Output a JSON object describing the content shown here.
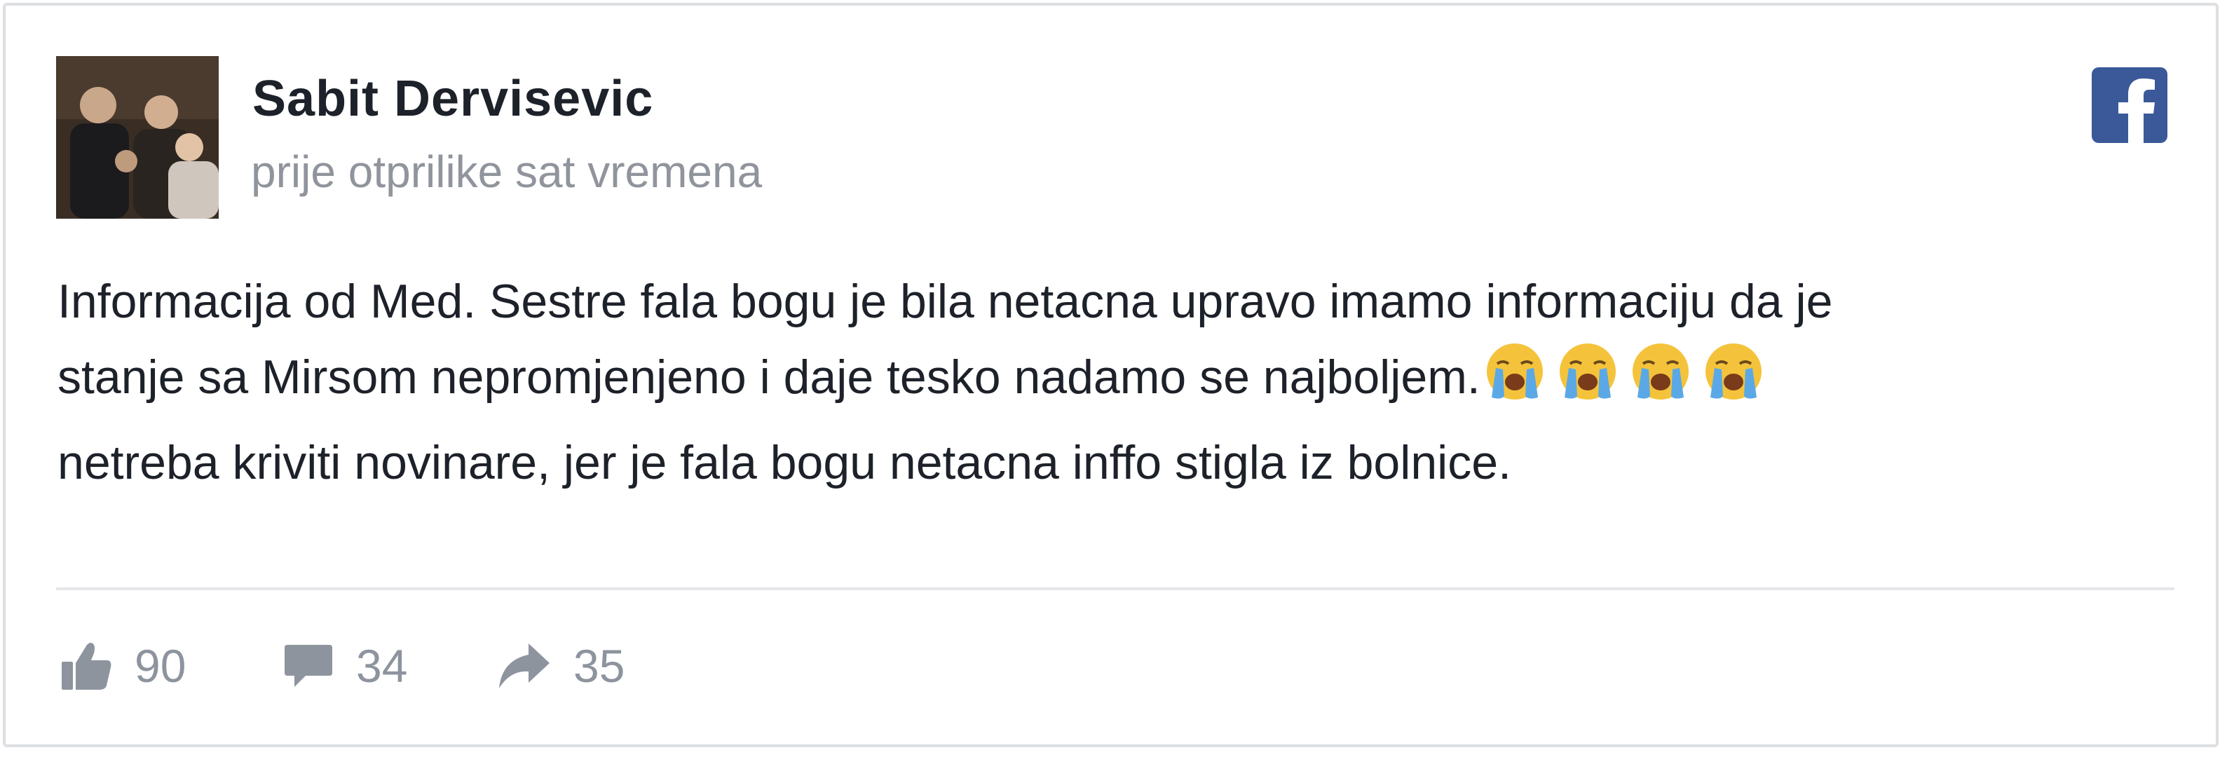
{
  "post": {
    "author": "Sabit Dervisevic",
    "timestamp": "prije otprilike sat vremena",
    "lines": [
      "Informacija od Med. Sestre fala bogu je bila netacna upravo imamo informaciju da je",
      "stanje sa Mirsom nepromjenjeno i daje tesko nadamo se najboljem.",
      "netreba kriviti novinare, jer je fala bogu netacna inffo stigla iz bolnice."
    ],
    "emojis": [
      "loudly-crying-face",
      "loudly-crying-face",
      "loudly-crying-face",
      "loudly-crying-face"
    ]
  },
  "stats": {
    "likes": "90",
    "comments": "34",
    "shares": "35"
  },
  "icons": {
    "brand": "facebook-logo-icon",
    "like": "thumbs-up-icon",
    "comment": "comment-bubble-icon",
    "share": "share-arrow-icon"
  },
  "colors": {
    "facebook_blue": "#3b5998",
    "text": "#1d2129",
    "muted": "#90949c",
    "border": "#dddfe2"
  }
}
